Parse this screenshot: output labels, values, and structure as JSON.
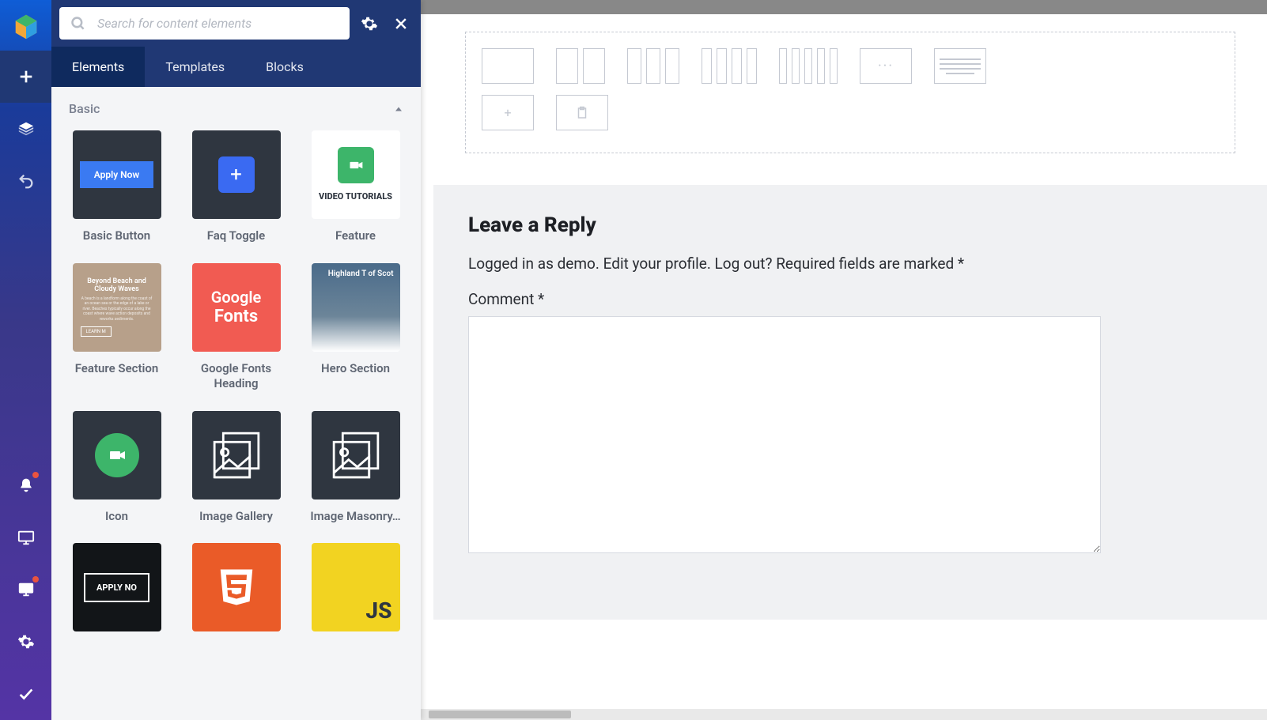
{
  "search": {
    "placeholder": "Search for content elements"
  },
  "tabs": [
    "Elements",
    "Templates",
    "Blocks"
  ],
  "section": {
    "title": "Basic"
  },
  "elements": {
    "basic_button": "Basic Button",
    "apply_now": "Apply Now",
    "faq_toggle": "Faq Toggle",
    "feature": "Feature",
    "video_tutorials": "VIDEO TUTORIALS",
    "feature_section": "Feature Section",
    "fsection_h": "Beyond Beach and Cloudy Waves",
    "google_fonts": "Google Fonts Heading",
    "google_l1": "Google",
    "google_l2": "Fonts",
    "hero_section": "Hero Section",
    "hero_h": "Highland T of Scot",
    "icon": "Icon",
    "image_gallery": "Image Gallery",
    "image_masonry": "Image Masonry…",
    "outline_apply": "APPLY NO",
    "js": "JS"
  },
  "reply": {
    "heading": "Leave a Reply",
    "logged1": "Logged in as ",
    "demo": "demo",
    "edit": "Edit your profile",
    "logout": "Log out?",
    "required": " Required fields are marked ",
    "asterisk": "*",
    "comment": "Comment ",
    "period": ". "
  }
}
